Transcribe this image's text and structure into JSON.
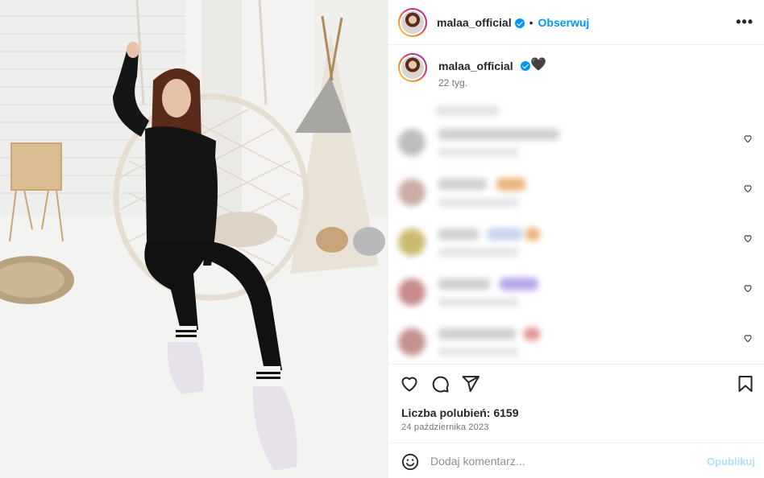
{
  "post": {
    "username": "malaa_official",
    "dot": "•",
    "follow_label": "Obserwuj",
    "more_label": "•••",
    "caption_emoji": "🖤",
    "time_ago": "22 tyg.",
    "likes_text": "Liczba polubień: 6159",
    "date": "24 października 2023",
    "comment_placeholder": "Dodaj komentarz...",
    "publish_label": "Opublikuj"
  },
  "icons": {
    "header": [
      "avatar",
      "verified-badge-icon",
      "more-options-icon"
    ],
    "actions": [
      "heart-icon",
      "comment-icon",
      "share-icon",
      "bookmark-icon"
    ],
    "comment_like": "heart-outline-icon",
    "composer": "smiley-icon"
  },
  "colors": {
    "accent": "#0095f6",
    "publish_disabled": "#b2dffc",
    "muted_text": "#737373"
  }
}
